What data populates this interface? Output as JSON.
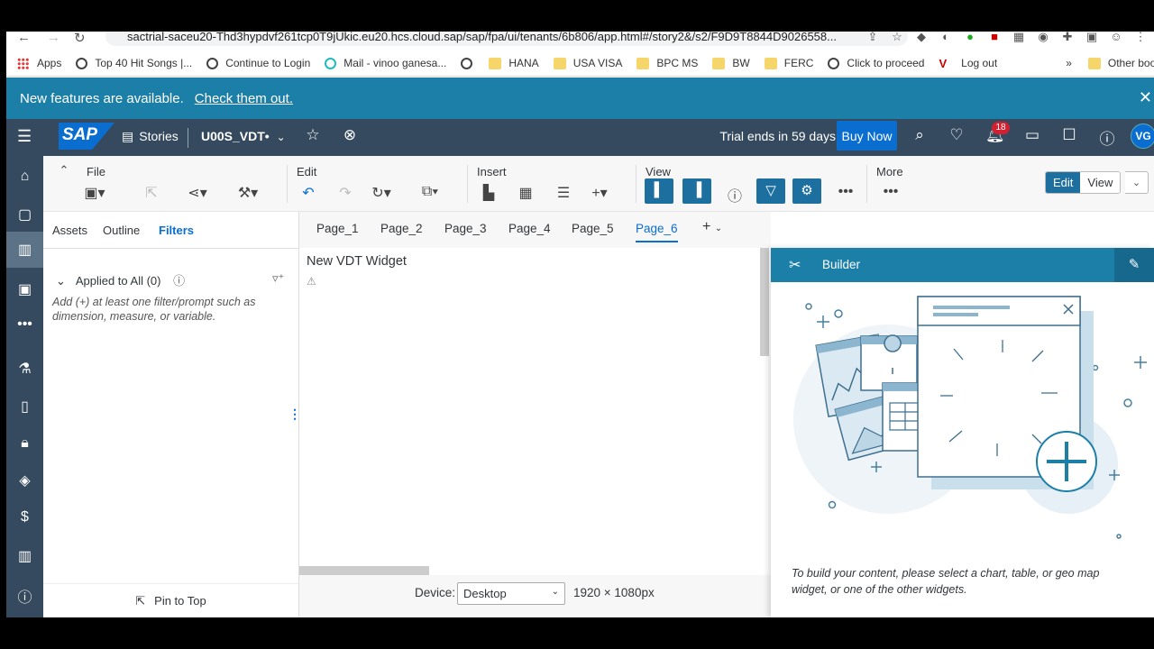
{
  "browser": {
    "url": "sactrial-saceu20-Thd3hypdvf261tcp0T9jUkic.eu20.hcs.cloud.sap/sap/fpa/ui/tenants/6b806/app.html#/story2&/s2/F9D9T8844D9026558...",
    "bookmarks": [
      {
        "label": "Apps",
        "icon": "apps-icon"
      },
      {
        "label": "Top 40 Hit Songs |...",
        "icon": "globe-icon"
      },
      {
        "label": "Continue to Login",
        "icon": "globe-icon"
      },
      {
        "label": "Mail - vinoo ganesa...",
        "icon": "mail-icon"
      },
      {
        "label": "",
        "icon": "globe-icon"
      },
      {
        "label": "HANA",
        "icon": "folder-icon"
      },
      {
        "label": "USA VISA",
        "icon": "folder-icon"
      },
      {
        "label": "BPC MS",
        "icon": "folder-icon"
      },
      {
        "label": "BW",
        "icon": "folder-icon"
      },
      {
        "label": "FERC",
        "icon": "folder-icon"
      },
      {
        "label": "Click to proceed",
        "icon": "globe-icon"
      },
      {
        "label": "Log out",
        "icon": "v-logo-icon"
      }
    ],
    "more_bookmarks": "»",
    "other_bookmarks": "Other bookmark"
  },
  "notification": {
    "text": "New features are available.",
    "link": "Check them out."
  },
  "shell": {
    "logo": "SAP",
    "stories": "Stories",
    "story_name": "U00S_VDT•",
    "trial": "Trial ends in 59 days",
    "buy_now": "Buy Now",
    "notification_count": "18",
    "avatar": "VG"
  },
  "toolbar": {
    "file": "File",
    "edit": "Edit",
    "insert": "Insert",
    "view": "View",
    "more": "More",
    "mode_edit": "Edit",
    "mode_view": "View"
  },
  "left_panel": {
    "tabs": [
      "Assets",
      "Outline",
      "Filters"
    ],
    "active_tab": "Filters",
    "applied": "Applied to All (0)",
    "hint": "Add (+) at least one filter/prompt such as dimension, measure, or variable.",
    "pin": "Pin to Top"
  },
  "pages": [
    "Page_1",
    "Page_2",
    "Page_3",
    "Page_4",
    "Page_5",
    "Page_6"
  ],
  "active_page": "Page_6",
  "canvas": {
    "widget_title": "New VDT Widget"
  },
  "status": {
    "device_label": "Device:",
    "device_value": "Desktop",
    "resolution": "1920 × 1080px"
  },
  "builder": {
    "title": "Builder",
    "hint": "To build your content, please select a chart, table, or geo map widget, or one of the other widgets."
  },
  "colors": {
    "shell": "#354a5f",
    "accent": "#0a6ed1",
    "notify": "#1b7fa8"
  }
}
